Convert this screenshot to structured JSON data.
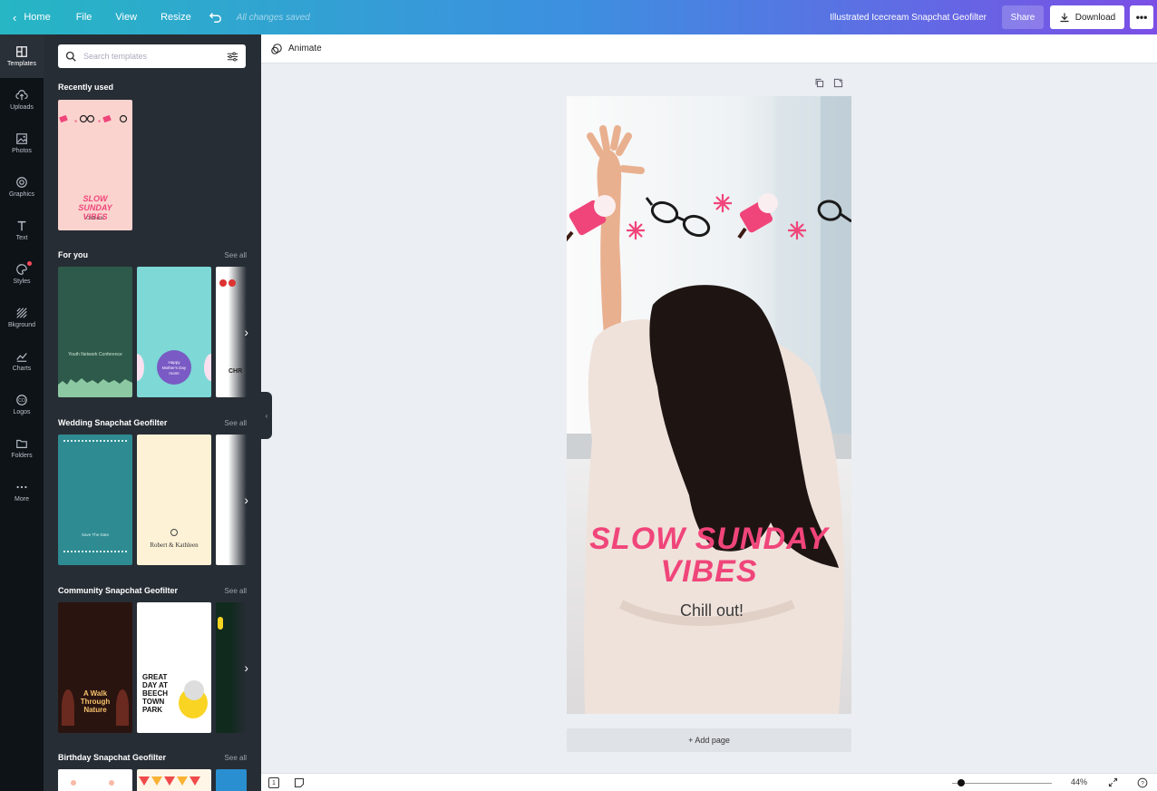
{
  "topbar": {
    "home": "Home",
    "file": "File",
    "view": "View",
    "resize": "Resize",
    "saved": "All changes saved",
    "title": "Illustrated Icecream Snapchat Geofilter",
    "share": "Share",
    "download": "Download"
  },
  "rail": [
    {
      "label": "Templates",
      "icon": "templates-icon"
    },
    {
      "label": "Uploads",
      "icon": "upload-icon"
    },
    {
      "label": "Photos",
      "icon": "photo-icon"
    },
    {
      "label": "Graphics",
      "icon": "graphics-icon"
    },
    {
      "label": "Text",
      "icon": "text-icon"
    },
    {
      "label": "Styles",
      "icon": "palette-icon"
    },
    {
      "label": "Bkground",
      "icon": "background-icon"
    },
    {
      "label": "Charts",
      "icon": "chart-icon"
    },
    {
      "label": "Logos",
      "icon": "logo-icon"
    },
    {
      "label": "Folders",
      "icon": "folder-icon"
    },
    {
      "label": "More",
      "icon": "more-icon"
    }
  ],
  "panel": {
    "search_placeholder": "Search templates",
    "recent": "Recently used",
    "foryou": "For you",
    "wedding": "Wedding Snapchat Geofilter",
    "community": "Community Snapchat Geofilter",
    "birthday": "Birthday Snapchat Geofilter",
    "see_all": "See all",
    "recent_thumb_title": "SLOW SUNDAY VIBES",
    "recent_thumb_sub": "Chill out!",
    "fy1": "Youth Network Conference",
    "fy2": "Happy Mother's Day mom!",
    "fy3": "CHR",
    "wd1": "Save The Date",
    "wd2": "Robert & Kathleen",
    "cm1": "A Walk Through Nature",
    "cm2": "GREAT DAY AT BEECH TOWN PARK"
  },
  "editor": {
    "animate": "Animate",
    "canvas_title": "SLOW SUNDAY VIBES",
    "canvas_sub": "Chill out!",
    "add_page": "+ Add page",
    "zoom": "44%",
    "page_num": "1"
  },
  "colors": {
    "accent_pink": "#f0457a",
    "panel_bg": "#272d35",
    "rail_bg": "#0e1318"
  }
}
